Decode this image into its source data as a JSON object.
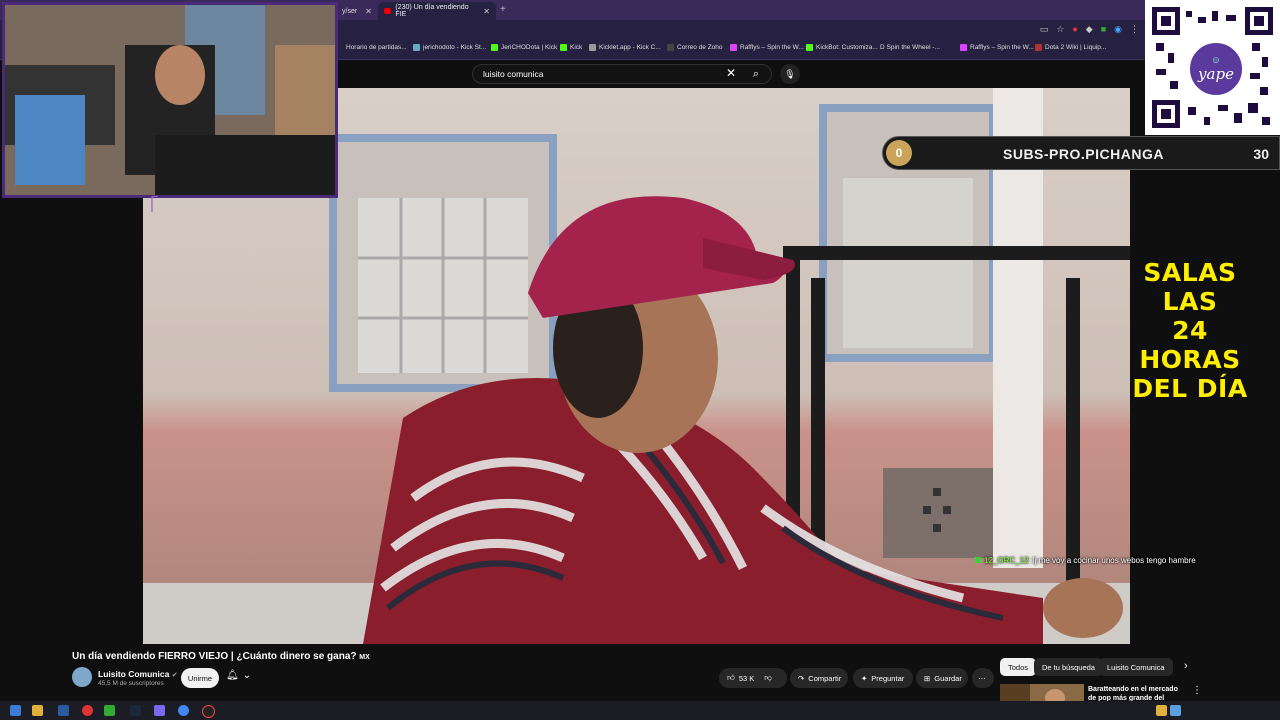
{
  "browser": {
    "tabs": [
      {
        "label": "y/ser",
        "active": false
      },
      {
        "label": "(230) Un día vendiendo FIE",
        "active": true
      }
    ],
    "bookmarks": [
      "Horario de partidas...",
      "jerichodoto - Kick St...",
      "JeriCHODota | Kick",
      "Kick",
      "Kicklet.app - Kick C...",
      "Correo de Zoho",
      "Rafflys – Spin the W...",
      "KickBot: Customiza...",
      "D Spin the Wheel -...",
      "Rafflys – Spin the W...",
      "Dota 2 Wiki | Liquip..."
    ]
  },
  "search": {
    "value": "luisito comunica"
  },
  "overlay": {
    "sub_bar": {
      "count_left": "0",
      "label": "SUBS-PRO.PICHANGA",
      "count_right": "30"
    },
    "promo_lines": [
      "SALAS LAS",
      "24 HORAS",
      "DEL DÍA"
    ],
    "qr_brand": "yape",
    "chat": {
      "user": "12_ORC_12",
      "message": ": lj me voy a cocinar unos webos tengo hambre"
    }
  },
  "video": {
    "title": "Un día vendiendo FIERRO VIEJO | ¿Cuánto dinero se gana?",
    "title_flag": "MX",
    "channel": "Luisito Comunica",
    "subscribers": "45,5 M de suscriptores",
    "join_label": "Unirme",
    "likes": "53 K",
    "share_label": "Compartir",
    "ask_label": "Preguntar",
    "save_label": "Guardar"
  },
  "chips": [
    "Todos",
    "De tu búsqueda",
    "Luisito Comunica"
  ],
  "recommendation": {
    "title": "Baratteando en el mercado de pop más grande del mundo |"
  },
  "colors": {
    "accent": "#ffee00",
    "cam_frame": "#4b2a7a",
    "chat_user": "#7aff3a"
  }
}
